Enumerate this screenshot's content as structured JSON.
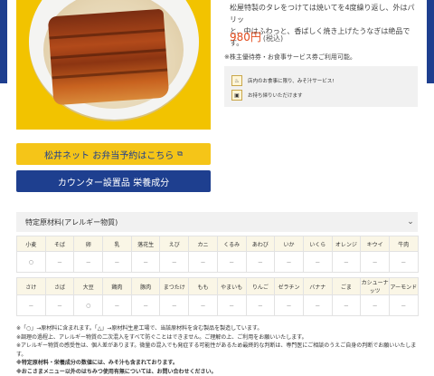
{
  "product": {
    "description_line1": "松屋特製のタレをつけては焼いてを4度繰り返し、外はパリッ",
    "description_line2": "と、中はふわっと、香ばしく焼き上げたうなぎは絶品です。",
    "price": "980円",
    "tax": "(税込)",
    "voucher_note": "※株主優待券・お食事サービス券ご利用可能。"
  },
  "service": {
    "items": [
      {
        "icon": "dine-in-icon",
        "label": "店内のお食事に限り、みそ汁サービス!"
      },
      {
        "icon": "takeout-icon",
        "label": "お持ち帰りいただけます"
      }
    ]
  },
  "buttons": {
    "bento_reserve": "松井ネット お弁当予約はこちら",
    "nutrition": "カウンター設置品 栄養成分"
  },
  "allergen": {
    "title": "特定原材料(アレルギー物質)",
    "row1": {
      "headers": [
        "小麦",
        "そば",
        "卵",
        "乳",
        "落花生",
        "えび",
        "カニ",
        "くるみ",
        "あわび",
        "いか",
        "いくら",
        "オレンジ",
        "キウイ",
        "牛肉"
      ],
      "values": [
        "○",
        "－",
        "－",
        "－",
        "－",
        "－",
        "－",
        "－",
        "－",
        "－",
        "－",
        "－",
        "－",
        "－"
      ]
    },
    "row2": {
      "headers": [
        "さけ",
        "さば",
        "大豆",
        "鶏肉",
        "豚肉",
        "まつたけ",
        "もも",
        "やまいも",
        "りんご",
        "ゼラチン",
        "バナナ",
        "ごま",
        "カシューナッツ",
        "アーモンド"
      ],
      "values": [
        "－",
        "－",
        "○",
        "－",
        "－",
        "－",
        "－",
        "－",
        "－",
        "－",
        "－",
        "－",
        "－",
        "－"
      ]
    }
  },
  "notes": {
    "line1": "※「○」→原材料に含まれます。「△」→原材料生産工場で、当該原材料を含む製品を製造しています。",
    "line2": "※調理の過程上、アレルギー物質の二次混入をすべて防ぐことはできません。ご理解の上、ご利用をお願いいたします。",
    "line3": "※アレルギー物質の感受性は、個人差があります。微量の混入でも発症する可能性があるため最終的な判断は、専門医にご相談のうえご自身の判断でお願いいたします。",
    "line4": "※特定原材料・栄養成分の数値には、みそ汁も含まれております。",
    "line5": "※おこさまメニュー以外のはちみつ使用有無については、お問い合わせください。"
  },
  "colors": {
    "brand_blue": "#1e3f8f",
    "brand_yellow": "#f5c518",
    "price_red": "#e24b1c"
  }
}
